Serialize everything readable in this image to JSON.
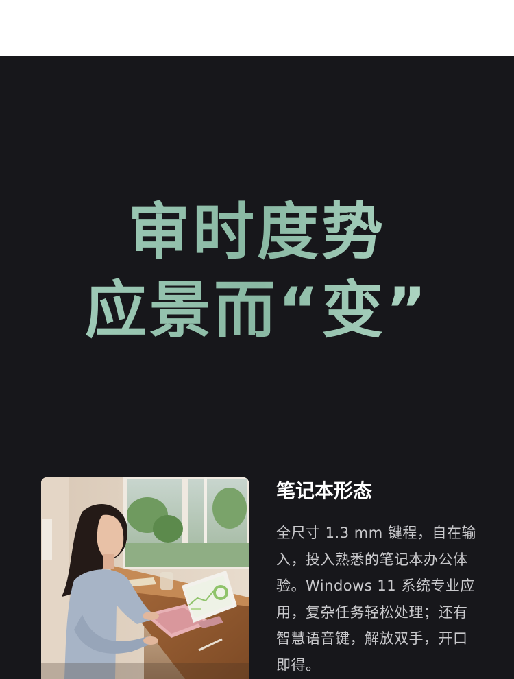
{
  "headline": {
    "line1": "审时度势",
    "line2": "应景而“变”"
  },
  "feature": {
    "title": "笔记本形态",
    "description": "全尺寸 1.3 mm 键程，自在输入，投入熟悉的笔记本办公体验。Windows 11 系统专业应用，复杂任务轻松处理；还有智慧语音键，解放双手，开口即得。"
  },
  "colors": {
    "background": "#17171b",
    "headline_gradient_start": "#a8d3c0",
    "headline_gradient_end": "#bfe3d2",
    "body_text": "#c9c9cc",
    "title_text": "#ffffff"
  }
}
